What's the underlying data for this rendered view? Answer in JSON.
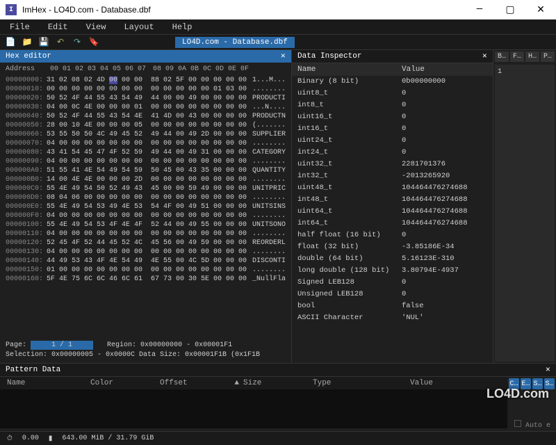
{
  "title": "ImHex - LO4D.com - Database.dbf",
  "menu": [
    "File",
    "Edit",
    "View",
    "Layout",
    "Help"
  ],
  "filetab": "LO4D.com - Database.dbf",
  "hex": {
    "title": "Hex editor",
    "addressLabel": "Address",
    "header1": "00 01 02 03 04 05 06 07",
    "header2": "08 09 0A 0B 0C 0D 0E 0F",
    "rows": [
      {
        "addr": "00000000:",
        "b": "31 02 08 02 4D 00 00 00  88 02 5F 00 00 00 00 00",
        "a": "1...M..."
      },
      {
        "addr": "00000010:",
        "b": "00 00 00 00 00 00 00 00  00 00 00 00 00 01 03 00",
        "a": "........"
      },
      {
        "addr": "00000020:",
        "b": "50 52 4F 44 55 43 54 49  44 00 00 49 00 00 00 00",
        "a": "PRODUCTI"
      },
      {
        "addr": "00000030:",
        "b": "04 00 0C 4E 00 00 00 01  00 00 00 00 00 00 00 00",
        "a": "...N...."
      },
      {
        "addr": "00000040:",
        "b": "50 52 4F 44 55 43 54 4E  41 4D 00 43 00 00 00 00",
        "a": "PRODUCTN"
      },
      {
        "addr": "00000050:",
        "b": "28 00 10 4E 00 00 00 05  00 00 00 00 00 00 00 00",
        "a": "(......."
      },
      {
        "addr": "00000060:",
        "b": "53 55 50 50 4C 49 45 52  49 44 00 49 2D 00 00 00",
        "a": "SUPPLIER"
      },
      {
        "addr": "00000070:",
        "b": "04 00 00 00 00 00 00 00  00 00 00 00 00 00 00 00",
        "a": "........"
      },
      {
        "addr": "00000080:",
        "b": "43 41 54 45 47 4F 52 59  49 44 00 49 31 00 00 00",
        "a": "CATEGORY"
      },
      {
        "addr": "00000090:",
        "b": "04 00 00 00 00 00 00 00  00 00 00 00 00 00 00 00",
        "a": "........"
      },
      {
        "addr": "000000A0:",
        "b": "51 55 41 4E 54 49 54 59  50 45 00 43 35 00 00 00",
        "a": "QUANTITY"
      },
      {
        "addr": "000000B0:",
        "b": "14 00 4E 4E 00 00 00 2D  00 00 00 00 00 00 00 00",
        "a": "........"
      },
      {
        "addr": "000000C0:",
        "b": "55 4E 49 54 50 52 49 43  45 00 00 59 49 00 00 00",
        "a": "UNITPRIC"
      },
      {
        "addr": "000000D0:",
        "b": "08 04 06 00 00 00 00 00  00 00 00 00 00 00 00 00",
        "a": "........"
      },
      {
        "addr": "000000E0:",
        "b": "55 4E 49 54 53 49 4E 53  54 4F 00 49 51 00 00 00",
        "a": "UNITSINS"
      },
      {
        "addr": "000000F0:",
        "b": "04 00 00 00 00 00 00 00  00 00 00 00 00 00 00 00",
        "a": "........"
      },
      {
        "addr": "00000100:",
        "b": "55 4E 49 54 53 4F 4E 4F  52 44 00 49 55 00 00 00",
        "a": "UNITSONO"
      },
      {
        "addr": "00000110:",
        "b": "04 00 00 00 00 00 00 00  00 00 00 00 00 00 00 00",
        "a": "........"
      },
      {
        "addr": "00000120:",
        "b": "52 45 4F 52 44 45 52 4C  45 56 00 49 59 00 00 00",
        "a": "REORDERL"
      },
      {
        "addr": "00000130:",
        "b": "04 00 00 00 00 00 00 00  00 00 00 00 00 00 00 00",
        "a": "........"
      },
      {
        "addr": "00000140:",
        "b": "44 49 53 43 4F 4E 54 49  4E 55 00 4C 5D 00 00 00",
        "a": "DISCONTI"
      },
      {
        "addr": "00000150:",
        "b": "01 00 00 00 00 00 00 00  00 00 00 00 00 00 00 00",
        "a": "........"
      },
      {
        "addr": "00000160:",
        "b": "5F 4E 75 6C 6C 46 6C 61  67 73 00 30 5E 00 00 00",
        "a": "_NullFla"
      }
    ],
    "pageLabel": "Page:",
    "page": "1 / 1",
    "region": "Region: 0x00000000 - 0x00001F1",
    "selection": "Selection: 0x00000005 - 0x0000C",
    "datasize": "Data Size: 0x00001F1B (0x1F1B"
  },
  "inspector": {
    "title": "Data Inspector",
    "headName": "Name",
    "headValue": "Value",
    "rows": [
      {
        "name": "Binary (8 bit)",
        "value": "0b00000000"
      },
      {
        "name": "uint8_t",
        "value": "0"
      },
      {
        "name": "int8_t",
        "value": "0"
      },
      {
        "name": "uint16_t",
        "value": "0"
      },
      {
        "name": "int16_t",
        "value": "0"
      },
      {
        "name": "uint24_t",
        "value": "0"
      },
      {
        "name": "int24_t",
        "value": "0"
      },
      {
        "name": "uint32_t",
        "value": "2281701376"
      },
      {
        "name": "int32_t",
        "value": "-2013265920"
      },
      {
        "name": "uint48_t",
        "value": "104464476274688"
      },
      {
        "name": "int48_t",
        "value": "104464476274688"
      },
      {
        "name": "uint64_t",
        "value": "104464476274688"
      },
      {
        "name": "int64_t",
        "value": "104464476274688"
      },
      {
        "name": "half float (16 bit)",
        "value": "0"
      },
      {
        "name": "float (32 bit)",
        "value": "-3.85186E-34"
      },
      {
        "name": "double (64 bit)",
        "value": "5.16123E-310"
      },
      {
        "name": "long double (128 bit)",
        "value": "3.80794E-4937"
      },
      {
        "name": "Signed LEB128",
        "value": "0"
      },
      {
        "name": "Unsigned LEB128",
        "value": "0"
      },
      {
        "name": "bool",
        "value": "false"
      },
      {
        "name": "ASCII Character",
        "value": "'NUL'"
      }
    ]
  },
  "sidetabs": [
    "B…",
    "F…",
    "H…",
    "P…"
  ],
  "sidenum": "1",
  "pattern": {
    "title": "Pattern Data",
    "cols": [
      "Name",
      "Color",
      "Offset",
      "Size",
      "Type",
      "Value"
    ],
    "arrow": "▲"
  },
  "badges": [
    "C…",
    "E…",
    "S…",
    "S…"
  ],
  "autoLabel": "Auto e",
  "status": {
    "fps": "0.00",
    "mem": "643.00 MiB / 31.79 GiB"
  },
  "watermark": "LO4D.com"
}
